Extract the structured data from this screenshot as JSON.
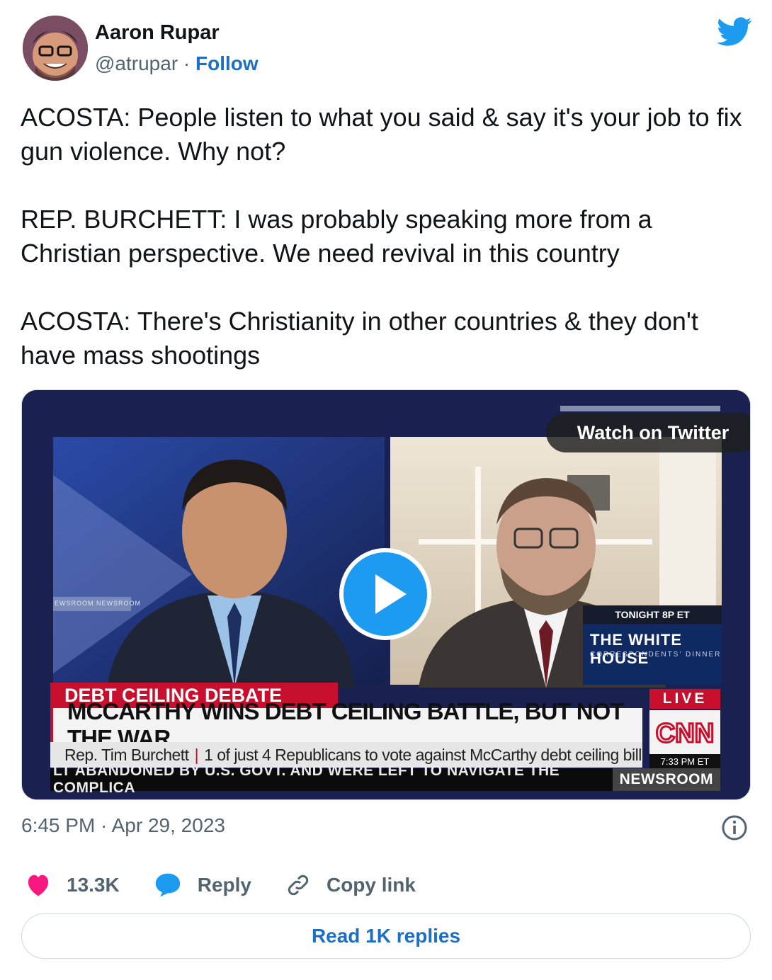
{
  "author": {
    "name": "Aaron Rupar",
    "handle": "@atrupar",
    "separator": "·",
    "follow_label": "Follow"
  },
  "tweet": {
    "paragraphs": [
      "ACOSTA: People listen to what you said & say it's your job to fix gun violence. Why not?",
      "REP. BURCHETT: I was probably speaking more from a Christian perspective. We need revival in this country",
      "ACOSTA: There's Christianity in other countries & they don't have mass shootings"
    ],
    "timestamp": "6:45 PM · Apr 29, 2023"
  },
  "media": {
    "watch_label": "Watch on Twitter",
    "chyron_top": "DEBT CEILING DEBATE",
    "chyron_main": "MCCARTHY WINS DEBT CEILING BATTLE, BUT NOT THE WAR",
    "chyron_name": "Rep. Tim Burchett",
    "chyron_detail": "1 of just 4 Republicans to vote against McCarthy debt ceiling bill",
    "ticker": "LT ABANDONED BY U.S. GOVT. AND WERE LEFT TO NAVIGATE THE COMPLICA",
    "ticker_tag": "NEWSROOM",
    "live_label": "LIVE",
    "network": "CNN",
    "clock": "7:33 PM ET",
    "promo_top": "TONIGHT 8P ET",
    "promo_title": "THE WHITE HOUSE",
    "promo_sub": "CORRESPONDENTS' DINNER",
    "wall_text": "EWSROOM NEWSROOM"
  },
  "actions": {
    "likes": "13.3K",
    "reply_label": "Reply",
    "copy_label": "Copy link"
  },
  "replies_button": "Read 1K replies",
  "colors": {
    "link": "#1d6fc4",
    "heart": "#f91880",
    "twitter_blue": "#1d9bf0",
    "muted": "#536471"
  }
}
